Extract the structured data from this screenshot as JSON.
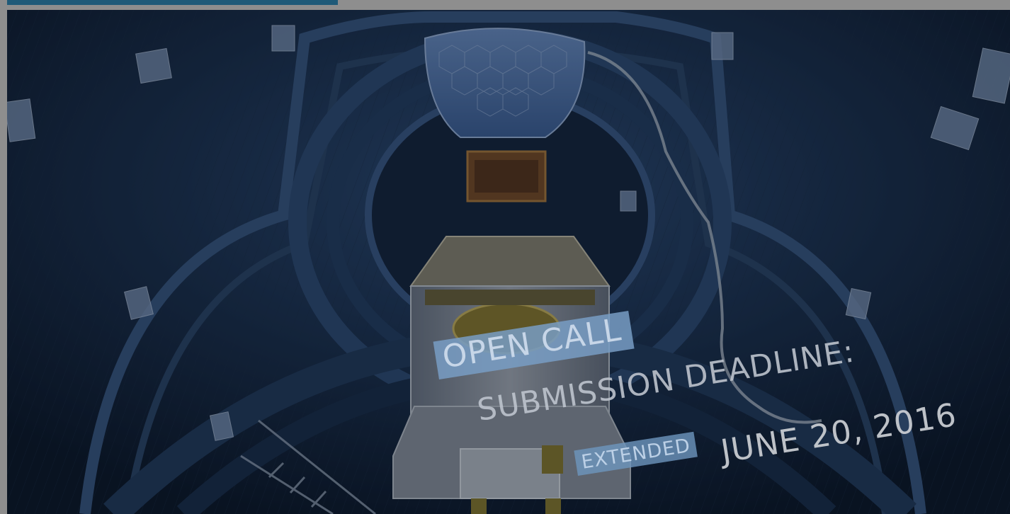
{
  "banner": {
    "open_call": "OPEN CALL",
    "deadline_label": "SUBMISSION DEADLINE:",
    "extended": "EXTENDED",
    "deadline_date": "JUNE 20, 2016"
  },
  "colors": {
    "top_bar": "#1f5a78",
    "page_background": "#8e8e8e",
    "open_call_tag": "#789ec4",
    "extended_tag": "#6e96be"
  }
}
